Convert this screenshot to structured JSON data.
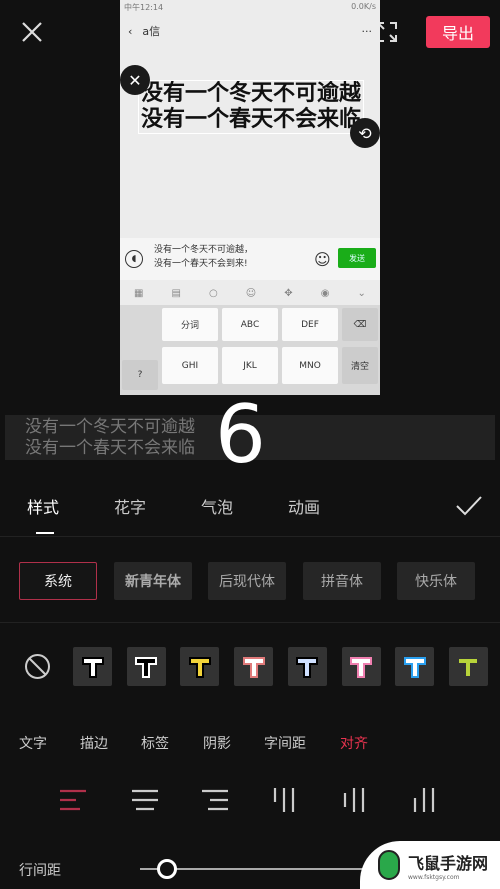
{
  "topbar": {
    "export_label": "导出"
  },
  "preview": {
    "status_left": "中午12:14",
    "status_right": "0.0K/s",
    "chat_title": "a信",
    "more": "···",
    "caption_lines": [
      "没有一个冬天不可逾越",
      "没有一个春天不会来临"
    ],
    "message_lines": [
      "没有一个冬天不可逾越，",
      "没有一个春天不会到来!"
    ],
    "send_label": "发送",
    "keys": {
      "k1": "分词",
      "k2": "ABC",
      "k3": "DEF",
      "k4": "GHI",
      "k5": "JKL",
      "k6": "MNO",
      "clear": "清空",
      "q": "?"
    }
  },
  "text_input": {
    "lines": [
      "没有一个冬天不可逾越",
      "没有一个春天不会来临"
    ]
  },
  "overlay_number": "6",
  "tabs": [
    {
      "label": "样式",
      "active": true
    },
    {
      "label": "花字"
    },
    {
      "label": "气泡"
    },
    {
      "label": "动画"
    }
  ],
  "fonts": [
    {
      "label": "系统",
      "selected": true
    },
    {
      "label": "新青年体"
    },
    {
      "label": "后现代体"
    },
    {
      "label": "拼音体"
    },
    {
      "label": "快乐体"
    }
  ],
  "swatches": [
    {
      "fill": "#ffffff",
      "stroke": "#000000"
    },
    {
      "fill": "#000000",
      "stroke": "#ffffff"
    },
    {
      "fill": "#f2d33a",
      "stroke": "#000000"
    },
    {
      "fill": "#ffffff",
      "stroke": "#e07a7a"
    },
    {
      "fill": "#cfe0ff",
      "stroke": "#000000"
    },
    {
      "fill": "#ffffff",
      "stroke": "#f07fb0"
    },
    {
      "fill": "#ffffff",
      "stroke": "#2aa0f0"
    },
    {
      "fill": "#b8d43a",
      "stroke": "#333333"
    }
  ],
  "subtabs": [
    {
      "label": "文字"
    },
    {
      "label": "描边"
    },
    {
      "label": "标签"
    },
    {
      "label": "阴影"
    },
    {
      "label": "字间距"
    },
    {
      "label": "对齐",
      "active": true
    }
  ],
  "align_icons": [
    "align-left-icon",
    "align-center-icon",
    "align-right-icon",
    "vertical-top-icon",
    "vertical-center-icon",
    "vertical-bottom-icon"
  ],
  "line_spacing": {
    "label": "行间距",
    "value_fraction": 0.1
  },
  "watermark": {
    "text": "飞鼠手游网",
    "url": "www.fsktgsy.com"
  },
  "colors": {
    "accent": "#f23a5c",
    "bg": "#111111"
  }
}
